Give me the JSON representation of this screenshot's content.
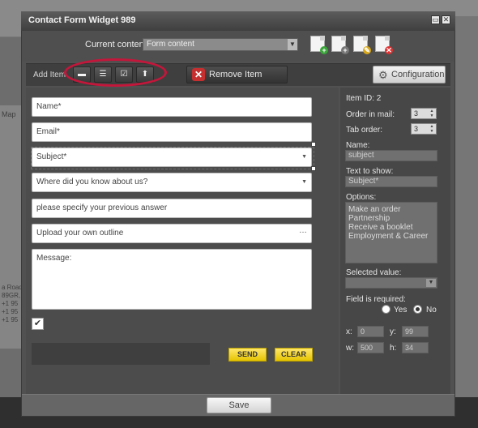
{
  "window": {
    "title": "Contact Form Widget 989"
  },
  "content_bar": {
    "label": "Current content:",
    "selected": "Form content"
  },
  "toolbar": {
    "add_label": "Add Item",
    "remove_label": "Remove Item",
    "config_label": "Configuration"
  },
  "form": {
    "fields": [
      "Name*",
      "Email*",
      "Subject*",
      "Where did you know about us?",
      "please specify your previous answer",
      "Upload your own outline"
    ],
    "message_label": "Message:",
    "send_label": "SEND",
    "clear_label": "CLEAR"
  },
  "side": {
    "item_id_label": "Item ID: 2",
    "order_label": "Order in mail:",
    "order_value": "3",
    "tab_label": "Tab order:",
    "tab_value": "3",
    "name_label": "Name:",
    "name_value": "subject",
    "text_label": "Text to show:",
    "text_value": "Subject*",
    "options_label": "Options:",
    "options": [
      "Make an order",
      "Partnership",
      "Receive a booklet",
      "Employment & Career"
    ],
    "selected_label": "Selected value:",
    "required_label": "Field is required:",
    "yes": "Yes",
    "no": "No",
    "x_label": "x:",
    "x_value": "0",
    "y_label": "y:",
    "y_value": "99",
    "w_label": "w:",
    "w_value": "500",
    "h_label": "h:",
    "h_value": "34"
  },
  "footer": {
    "save_label": "Save"
  },
  "background": {
    "map_label": "Map",
    "road_text": "a Road,",
    "postcode": "89GR,",
    "phones": [
      "+1 95",
      "+1 95",
      "+1 95"
    ]
  }
}
